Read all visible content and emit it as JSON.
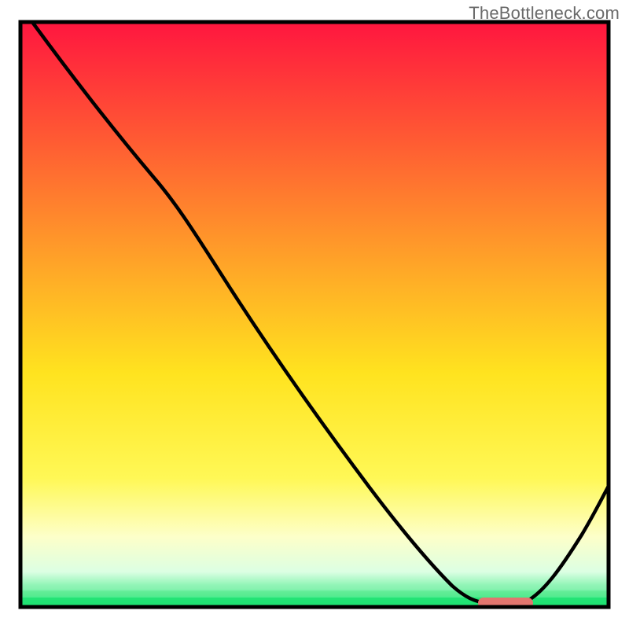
{
  "watermark": "TheBottleneck.com",
  "chart_data": {
    "type": "line",
    "title": "",
    "xlabel": "",
    "ylabel": "",
    "xlim": [
      0,
      100
    ],
    "ylim": [
      0,
      100
    ],
    "grid": false,
    "legend": false,
    "gradient_stops": [
      {
        "offset": 0,
        "color": "#ff163f"
      },
      {
        "offset": 20,
        "color": "#ff5a33"
      },
      {
        "offset": 45,
        "color": "#ffb126"
      },
      {
        "offset": 60,
        "color": "#ffe31f"
      },
      {
        "offset": 78,
        "color": "#fff856"
      },
      {
        "offset": 88,
        "color": "#fdffc9"
      },
      {
        "offset": 94,
        "color": "#dcffe3"
      },
      {
        "offset": 100,
        "color": "#15e46c"
      }
    ],
    "curve": {
      "description": "Bottleneck curve: high on left, descends to zero trough around x=78-86, rises again on right",
      "points": [
        {
          "x": 2,
          "y": 100
        },
        {
          "x": 10,
          "y": 90
        },
        {
          "x": 18,
          "y": 80
        },
        {
          "x": 24,
          "y": 72
        },
        {
          "x": 32,
          "y": 61
        },
        {
          "x": 40,
          "y": 49
        },
        {
          "x": 48,
          "y": 38
        },
        {
          "x": 56,
          "y": 26
        },
        {
          "x": 64,
          "y": 14
        },
        {
          "x": 70,
          "y": 6
        },
        {
          "x": 74,
          "y": 2
        },
        {
          "x": 78,
          "y": 0.5
        },
        {
          "x": 82,
          "y": 0.5
        },
        {
          "x": 86,
          "y": 0.5
        },
        {
          "x": 90,
          "y": 7
        },
        {
          "x": 94,
          "y": 14
        },
        {
          "x": 98,
          "y": 21
        }
      ]
    },
    "marker": {
      "description": "Optimal-zone pill marker at trough",
      "x_center": 82,
      "width": 9,
      "y": 0.5,
      "color": "#e2766f"
    },
    "frame": {
      "color": "#000000",
      "width": 5
    }
  }
}
